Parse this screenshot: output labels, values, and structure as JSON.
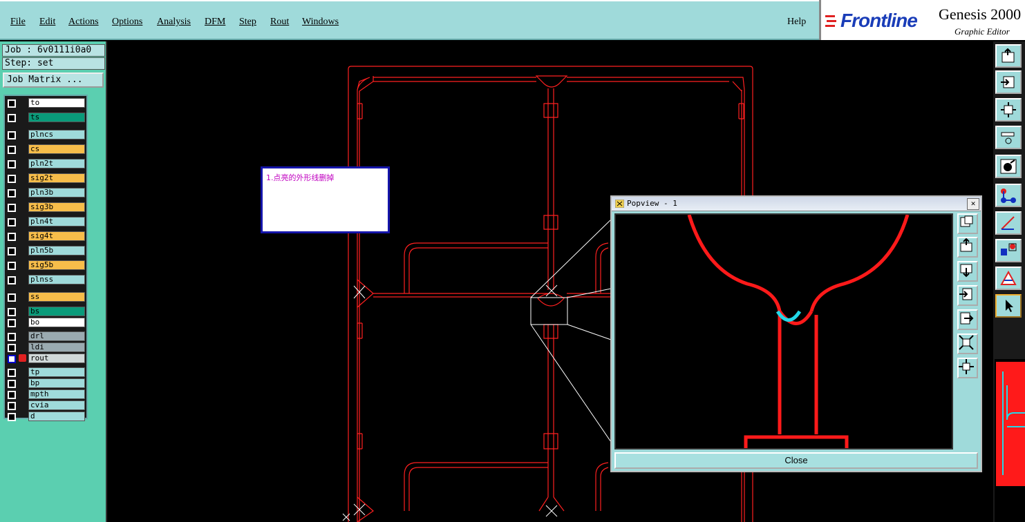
{
  "menu": {
    "items": [
      "File",
      "Edit",
      "Actions",
      "Options",
      "Analysis",
      "DFM",
      "Step",
      "Rout",
      "Windows"
    ],
    "help": "Help"
  },
  "brand": {
    "logo": "Frontline",
    "title": "Genesis 2000",
    "subtitle": "Graphic Editor"
  },
  "left": {
    "job": "Job : 6v0111i0a0",
    "step": "Step: set",
    "job_matrix": "Job Matrix ..."
  },
  "layers": [
    {
      "name": "to",
      "color": "#ffffff"
    },
    {
      "name": "ts",
      "color": "#0a9b7a"
    },
    {
      "name": "plncs",
      "color": "#9fdada"
    },
    {
      "name": "cs",
      "color": "#f7bd4a"
    },
    {
      "name": "pln2t",
      "color": "#9fdada"
    },
    {
      "name": "sig2t",
      "color": "#f7bd4a"
    },
    {
      "name": "pln3b",
      "color": "#9fdada"
    },
    {
      "name": "sig3b",
      "color": "#f7bd4a"
    },
    {
      "name": "pln4t",
      "color": "#9fdada"
    },
    {
      "name": "sig4t",
      "color": "#f7bd4a"
    },
    {
      "name": "pln5b",
      "color": "#9fdada"
    },
    {
      "name": "sig5b",
      "color": "#f7bd4a"
    },
    {
      "name": "plnss",
      "color": "#9fdada"
    },
    {
      "name": "ss",
      "color": "#f7bd4a"
    },
    {
      "name": "bs",
      "color": "#0a9b7a"
    },
    {
      "name": "bo",
      "color": "#ffffff"
    },
    {
      "name": "drl",
      "color": "#9aaab0"
    },
    {
      "name": "ldi",
      "color": "#9aaab0"
    },
    {
      "name": "rout",
      "color": "#d0d8d8",
      "active": true
    },
    {
      "name": "tp",
      "color": "#9fdada"
    },
    {
      "name": "bp",
      "color": "#9fdada"
    },
    {
      "name": "mpth",
      "color": "#9fdada"
    },
    {
      "name": "cvia",
      "color": "#9fdada"
    },
    {
      "name": "d",
      "color": "#9fdada"
    }
  ],
  "note": {
    "text": "1.点亮的外形线删掉"
  },
  "popup": {
    "title": "Popview - 1",
    "close_label": "Close"
  },
  "colors": {
    "panel": "#9fdada",
    "left_panel": "#5bcfb0",
    "rout_line": "#ff1a1a",
    "highlight": "#22d8e8"
  }
}
